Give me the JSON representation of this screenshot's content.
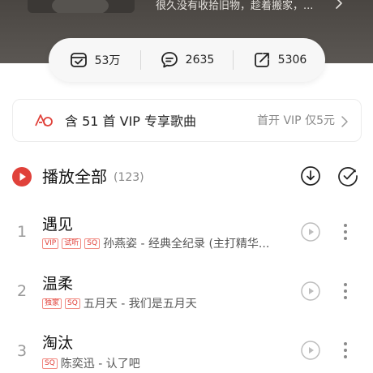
{
  "header": {
    "description": "很久没有收拾旧物，趁着搬家，..."
  },
  "stats": {
    "collect_count": "53万",
    "comment_count": "2635",
    "share_count": "5306"
  },
  "vip_banner": {
    "text": "含 51 首 VIP 专享歌曲",
    "action": "首开 VIP 仅5元"
  },
  "play_all": {
    "label": "播放全部",
    "count": "(123)"
  },
  "songs": [
    {
      "index": "1",
      "title": "遇见",
      "tags": [
        "VIP",
        "试听",
        "SQ"
      ],
      "subtitle": "孙燕姿 - 经典全纪录 (主打精华..."
    },
    {
      "index": "2",
      "title": "温柔",
      "tags": [
        "独家",
        "SQ"
      ],
      "subtitle": "五月天 - 我们是五月天"
    },
    {
      "index": "3",
      "title": "淘汰",
      "tags": [
        "SQ"
      ],
      "subtitle": "陈奕迅 - 认了吧"
    }
  ],
  "colors": {
    "accent": "#e0413a",
    "header_band": "#4a4642",
    "pill_bg": "#f7f7f7"
  },
  "icons": {
    "collect": "collect-icon",
    "comment": "comment-icon",
    "share": "share-icon",
    "vip": "vip-icon",
    "play_all": "play-circle-icon",
    "download": "download-icon",
    "multiselect": "multiselect-check-icon",
    "mv": "play-mv-icon",
    "more": "more-vertical-icon"
  }
}
